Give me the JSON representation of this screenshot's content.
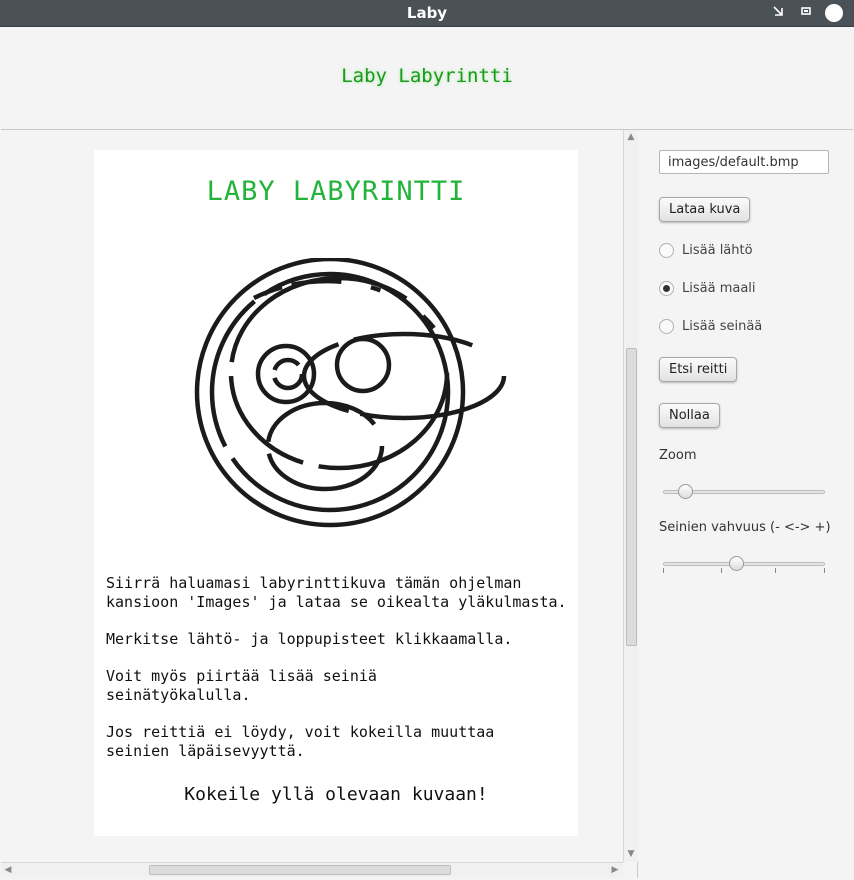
{
  "window": {
    "title": "Laby"
  },
  "header": {
    "title": "Laby Labyrintti"
  },
  "canvas": {
    "title": "LABY LABYRINTTI",
    "instructions": [
      "Siirrä haluamasi labyrinttikuva tämän ohjelman",
      "kansioon 'Images' ja lataa se oikealta yläkulmasta.",
      "Merkitse lähtö- ja loppupisteet klikkaamalla.",
      "Voit myös piirtää lisää seiniä",
      "seinätyökalulla.",
      "Jos reittiä ei löydy, voit kokeilla muuttaa",
      "seinien läpäisevyyttä."
    ],
    "try_text": "Kokeile yllä olevaan kuvaan!"
  },
  "sidebar": {
    "file_field": "images/default.bmp",
    "load_button": "Lataa kuva",
    "radios": [
      {
        "label": "Lisää lähtö",
        "selected": false
      },
      {
        "label": "Lisää maali",
        "selected": true
      },
      {
        "label": "Lisää seinää",
        "selected": false
      }
    ],
    "find_button": "Etsi reitti",
    "reset_button": "Nollaa",
    "zoom_label": "Zoom",
    "zoom_value": 0.1,
    "wall_label": "Seinien vahvuus (- <-> +)",
    "wall_value": 0.45
  }
}
